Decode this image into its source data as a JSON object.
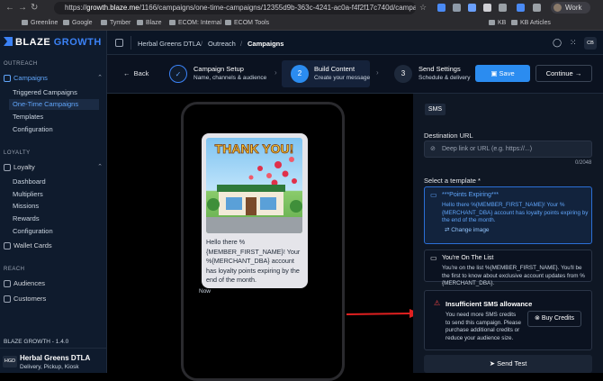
{
  "browser": {
    "url_prefix": "https://",
    "url_host": "growth.blaze.me",
    "url_path": "/1166/campaigns/one-time-campaigns/12355d9b-363c-4241-ac0a-f4f2f17c740d/campaign/b...",
    "profile": "Work",
    "bookmarks": [
      "Greenline",
      "Google",
      "Tymber",
      "Blaze",
      "ECOM: Internal",
      "ECOM Tools",
      "KB",
      "KB Articles"
    ]
  },
  "sidebar": {
    "brand_a": "BLAZE",
    "brand_b": " GROWTH",
    "outreach_label": "OUTREACH",
    "campaigns": "Campaigns",
    "campaign_items": [
      "Triggered Campaigns",
      "One-Time Campaigns",
      "Templates",
      "Configuration"
    ],
    "loyalty_label": "LOYALTY",
    "loyalty": "Loyalty",
    "loyalty_items": [
      "Dashboard",
      "Multipliers",
      "Missions",
      "Rewards",
      "Configuration"
    ],
    "wallet": "Wallet Cards",
    "reach_label": "REACH",
    "audiences": "Audiences",
    "customers": "Customers",
    "version": "BLAZE GROWTH - 1.4.0",
    "store_badge": "HGD",
    "store_name": "Herbal Greens DTLA",
    "store_sub": "Delivery, Pickup, Kiosk"
  },
  "topbar": {
    "crumb1": "Herbal Greens DTLA",
    "crumb2": "Outreach",
    "crumb3": "Campaigns",
    "avatar": "CB"
  },
  "stepper": {
    "back": "Back",
    "steps": [
      {
        "title": "Campaign Setup",
        "desc": "Name, channels & audience",
        "num": "✓"
      },
      {
        "title": "Build Content",
        "desc": "Create your message",
        "num": "2"
      },
      {
        "title": "Send Settings",
        "desc": "Schedule & delivery",
        "num": "3"
      }
    ],
    "save": "Save",
    "continue": "Continue"
  },
  "preview": {
    "image_text": "THANK YOU!",
    "message": "Hello there %{MEMBER_FIRST_NAME}! Your %{MERCHANT_DBA} account has loyalty points expiring by the end of the month.",
    "timestamp": "Now"
  },
  "editor": {
    "channel_tab": "SMS",
    "destination_label": "Destination URL",
    "destination_placeholder": "Deep link or URL (e.g. https://...)",
    "char_count": "0/2048",
    "template_label": "Select a template *",
    "templates": [
      {
        "title": "***Points Expiring***",
        "body": "Hello there %{MEMBER_FIRST_NAME}! Your %{MERCHANT_DBA} account has loyalty points expiring by the end of the month.",
        "action": "Change image"
      },
      {
        "title": "You're On The List",
        "body": "You're on the list %{MEMBER_FIRST_NAME}. You'll be the first to know about exclusive account updates from %{MERCHANT_DBA}."
      }
    ],
    "warning_title": "Insufficient SMS allowance",
    "warning_body": "You need more SMS credits to send this campaign. Please purchase additional credits or reduce your audience size.",
    "buy_credits": "Buy Credits",
    "send_test": "Send Test"
  },
  "colors": {
    "accent": "#2b8cf0",
    "warning": "#ef4444",
    "arrow": "#e02020"
  }
}
